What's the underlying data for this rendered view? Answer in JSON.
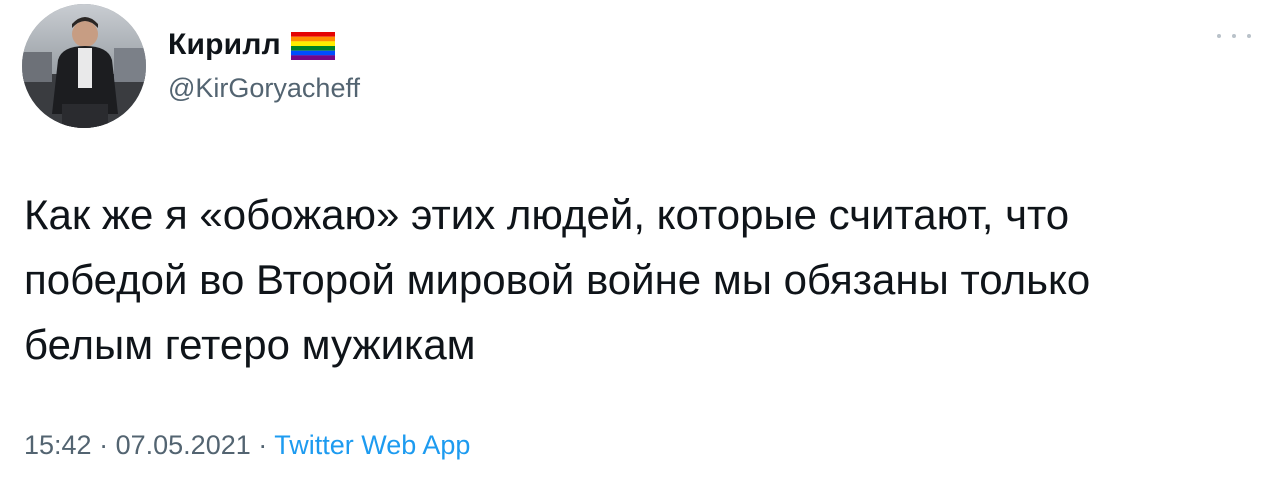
{
  "author": {
    "display_name": "Кирилл",
    "handle": "@KirGoryacheff",
    "badge_icon": "rainbow-flag-icon"
  },
  "tweet": {
    "lines": [
      "Как же я «обожаю» этих людей, которые считают, что",
      "победой во Второй мировой войне мы обязаны только",
      "белым гетеро мужикам"
    ],
    "time": "15:42",
    "separator": "·",
    "date": "07.05.2021",
    "source": "Twitter Web App"
  },
  "menu": {
    "icon": "more-options-icon"
  },
  "colors": {
    "text": "#0f1419",
    "secondary": "#536471",
    "link": "#1d9bf0",
    "background": "#ffffff"
  }
}
